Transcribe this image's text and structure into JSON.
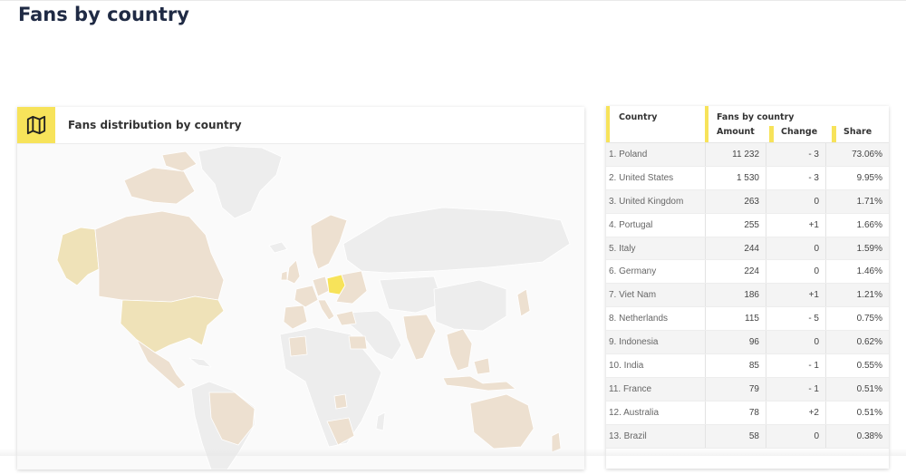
{
  "page": {
    "title": "Fans by country"
  },
  "map_card": {
    "title": "Fans distribution by country",
    "icon": "map-icon",
    "colors": {
      "highlight": "#f7e35a",
      "usa": "#efe2b8",
      "fans": "#ede0d0",
      "no_fans": "#ededed",
      "border": "#ffffff"
    }
  },
  "table": {
    "headers": {
      "country": "Country",
      "fans_group": "Fans by country",
      "amount": "Amount",
      "change": "Change",
      "share": "Share"
    },
    "rows": [
      {
        "country": "1. Poland",
        "amount": "11 232",
        "change": "- 3",
        "share": "73.06%"
      },
      {
        "country": "2. United States",
        "amount": "1 530",
        "change": "- 3",
        "share": "9.95%"
      },
      {
        "country": "3. United Kingdom",
        "amount": "263",
        "change": "0",
        "share": "1.71%"
      },
      {
        "country": "4. Portugal",
        "amount": "255",
        "change": "+1",
        "share": "1.66%"
      },
      {
        "country": "5. Italy",
        "amount": "244",
        "change": "0",
        "share": "1.59%"
      },
      {
        "country": "6. Germany",
        "amount": "224",
        "change": "0",
        "share": "1.46%"
      },
      {
        "country": "7. Viet Nam",
        "amount": "186",
        "change": "+1",
        "share": "1.21%"
      },
      {
        "country": "8. Netherlands",
        "amount": "115",
        "change": "- 5",
        "share": "0.75%"
      },
      {
        "country": "9. Indonesia",
        "amount": "96",
        "change": "0",
        "share": "0.62%"
      },
      {
        "country": "10. India",
        "amount": "85",
        "change": "- 1",
        "share": "0.55%"
      },
      {
        "country": "11. France",
        "amount": "79",
        "change": "- 1",
        "share": "0.51%"
      },
      {
        "country": "12. Australia",
        "amount": "78",
        "change": "+2",
        "share": "0.51%"
      },
      {
        "country": "13. Brazil",
        "amount": "58",
        "change": "0",
        "share": "0.38%"
      }
    ],
    "accent_color": "#f7e35a"
  }
}
